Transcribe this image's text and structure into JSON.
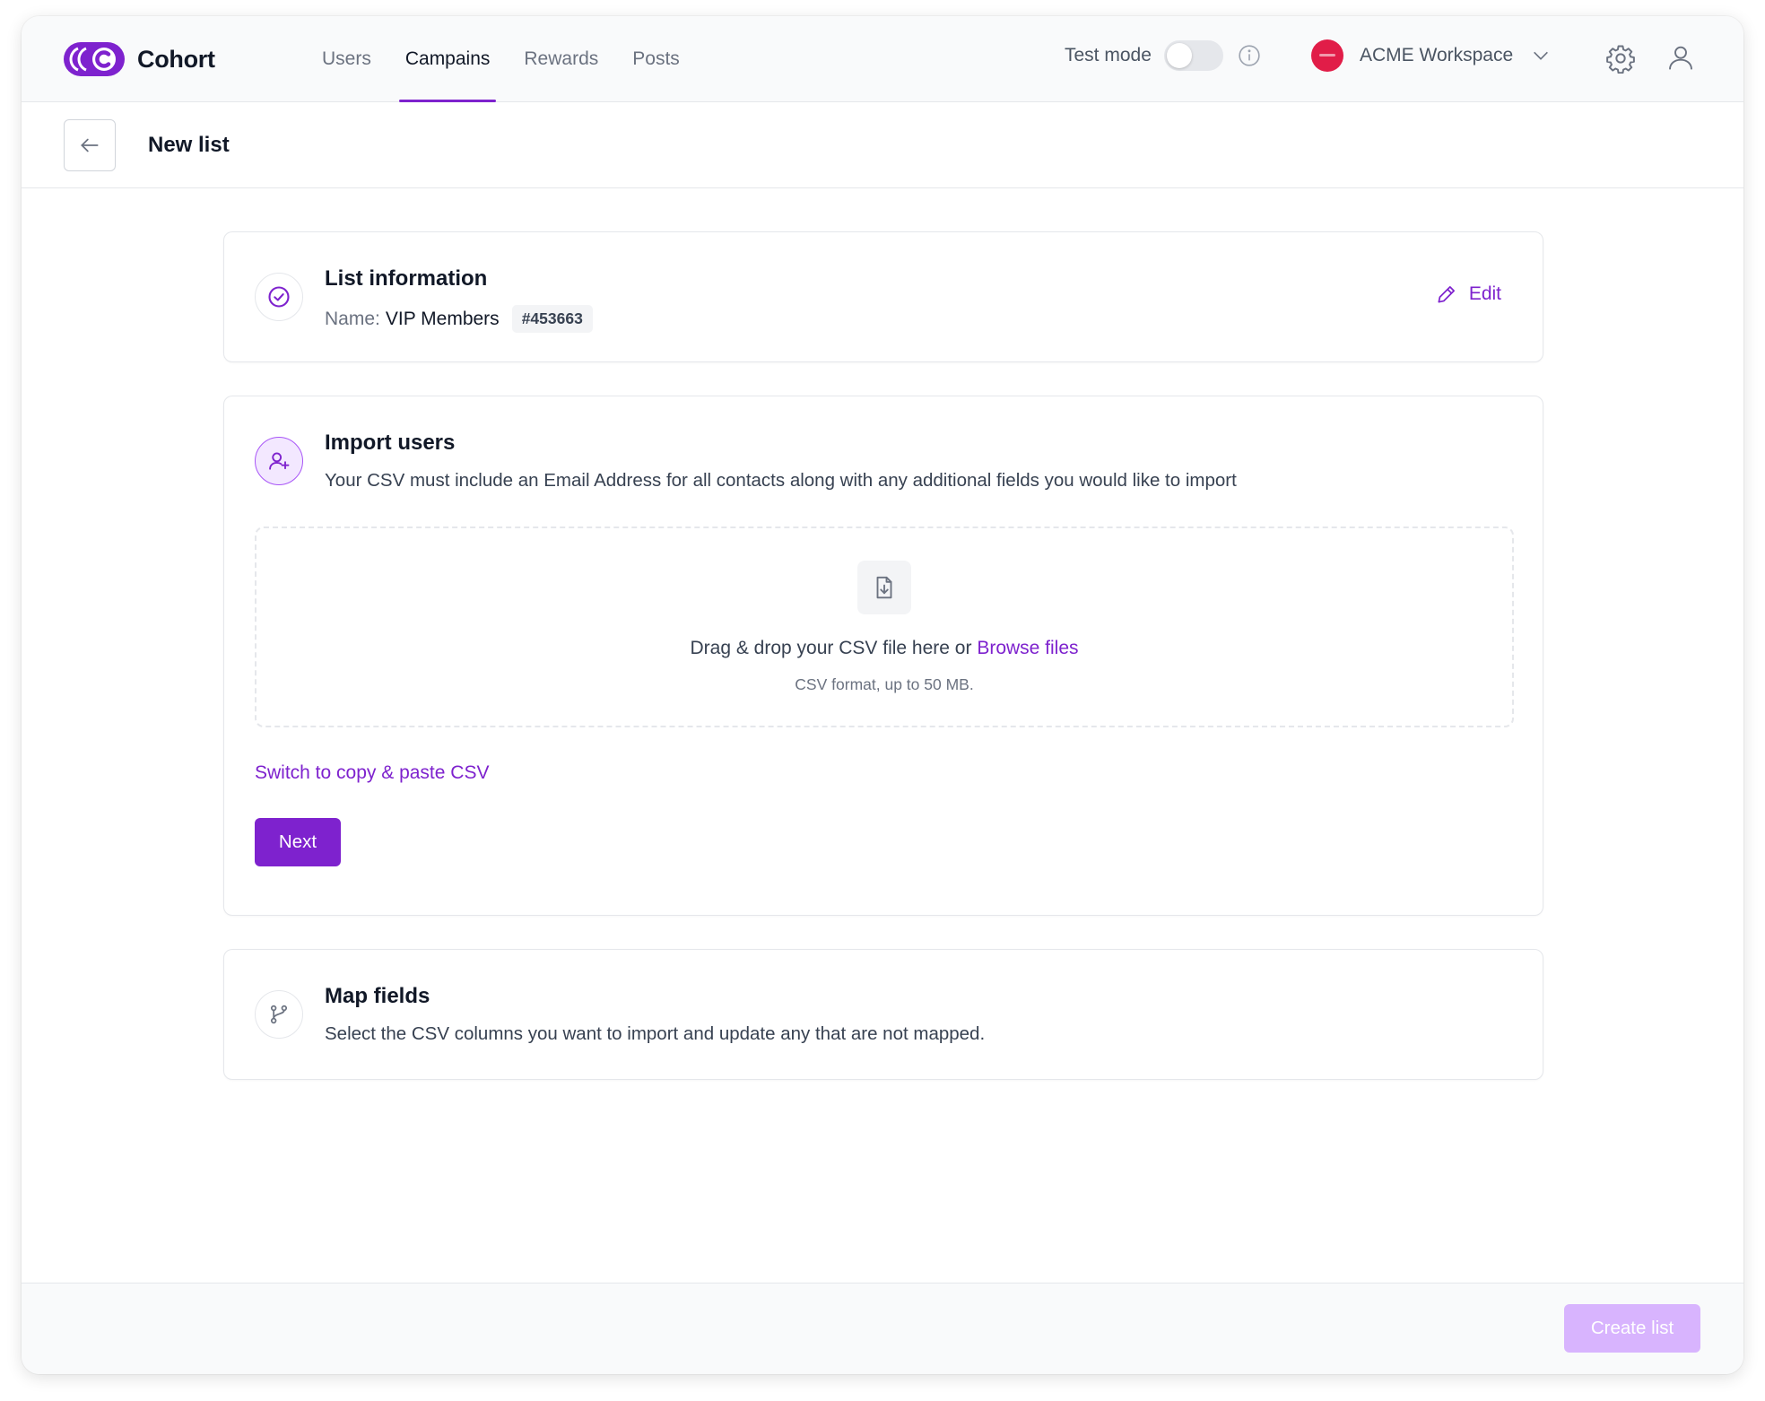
{
  "app": {
    "name": "Cohort"
  },
  "nav": {
    "tabs": [
      {
        "label": "Users",
        "active": false
      },
      {
        "label": "Campains",
        "active": true
      },
      {
        "label": "Rewards",
        "active": false
      },
      {
        "label": "Posts",
        "active": false
      }
    ],
    "test_mode": {
      "label": "Test mode",
      "enabled": false
    },
    "workspace": {
      "name": "ACME Workspace"
    },
    "icons": [
      "info-icon",
      "chevron-down-icon",
      "gear-icon",
      "user-icon"
    ]
  },
  "header": {
    "title": "New list",
    "back_icon": "arrow-left-icon"
  },
  "list_info": {
    "title": "List information",
    "name_label": "Name:",
    "name_value": "VIP Members",
    "id_badge": "#453663",
    "edit_label": "Edit",
    "status_icon": "check-circle-icon"
  },
  "import_users": {
    "title": "Import users",
    "description": "Your CSV must include an Email Address for all contacts along with any additional fields you would like to import",
    "dropzone": {
      "text": "Drag & drop your CSV file here or",
      "browse_label": "Browse files",
      "subtext": "CSV format, up to 50 MB.",
      "icon": "file-download-icon"
    },
    "switch_label": "Switch to copy & paste CSV",
    "next_label": "Next"
  },
  "map_fields": {
    "title": "Map fields",
    "description": "Select the CSV columns you want to import and update any that are not mapped.",
    "icon": "git-branch-icon"
  },
  "footer": {
    "create_label": "Create list"
  },
  "colors": {
    "accent": "#7e22ce",
    "accent_disabled": "#d8b4fe",
    "workspace_avatar": "#e11d48"
  }
}
